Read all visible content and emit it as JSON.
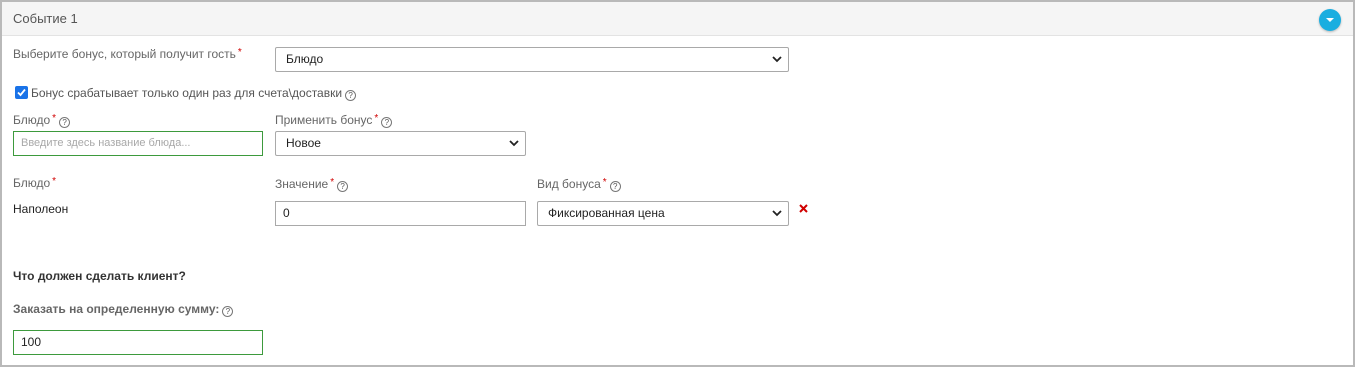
{
  "panel": {
    "title": "Событие 1"
  },
  "bonus_select": {
    "label": "Выберите бонус, который получит гость",
    "value": "Блюдо"
  },
  "once_checkbox": {
    "label": "Бонус срабатывает только один раз для счета\\доставки",
    "checked": true
  },
  "dish_search": {
    "label": "Блюдо",
    "placeholder": "Введите здесь название блюда..."
  },
  "apply_bonus": {
    "label": "Применить бонус",
    "value": "Новое"
  },
  "bonus_row": {
    "dish_label": "Блюдо",
    "dish_value": "Наполеон",
    "value_label": "Значение",
    "value": "0",
    "type_label": "Вид бонуса",
    "type_value": "Фиксированная цена"
  },
  "client_action": {
    "heading": "Что должен сделать клиент?",
    "order_label": "Заказать на определенную сумму:",
    "order_amount": "100"
  },
  "required_mark": "*",
  "help_mark": "?",
  "colors": {
    "accent": "#1aaee0",
    "required": "#d00000",
    "valid_border": "#3d9a3d",
    "checkbox": "#1a73e8"
  }
}
